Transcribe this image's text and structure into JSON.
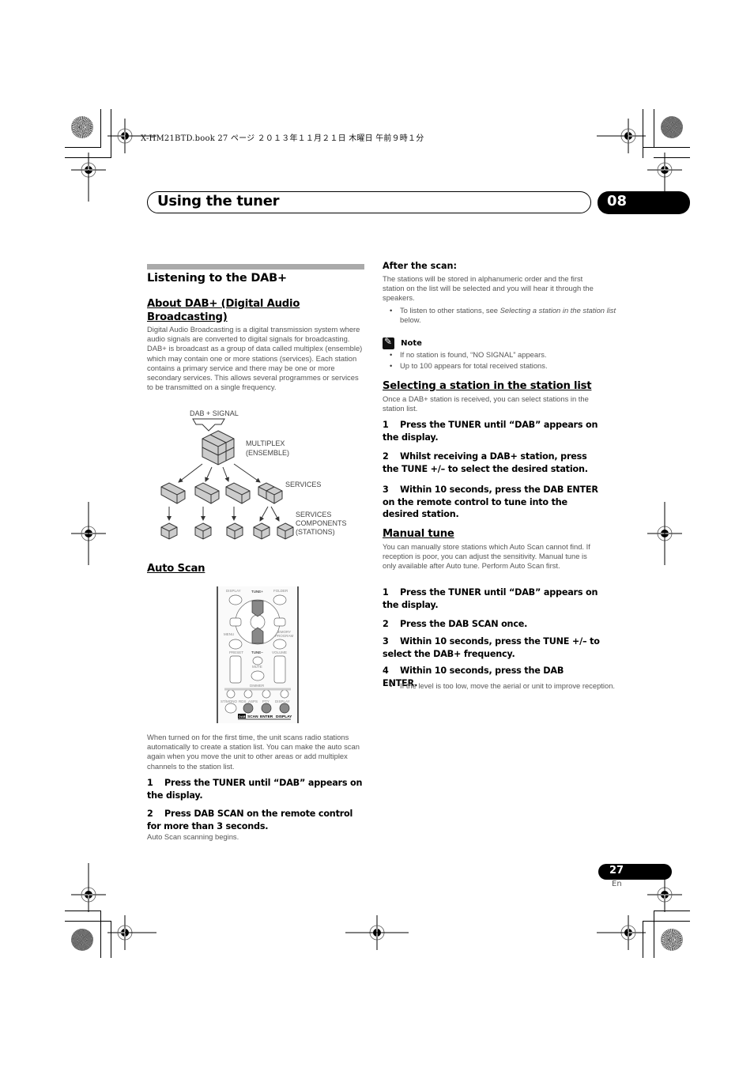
{
  "slug": {
    "text": "X-HM21BTD.book  27 ページ  ２０１３年１１月２１日  木曜日  午前９時１分"
  },
  "header": {
    "title": "Using the tuner",
    "chapter": "08"
  },
  "left_column": {
    "section_title": "Listening to the DAB+",
    "about": {
      "heading": "About DAB+ (Digital Audio Broadcasting)",
      "body": "Digital Audio Broadcasting is a digital transmission system where audio signals are converted to digital signals for broadcasting. DAB+ is broadcast as a group of data called multiplex (ensemble) which may contain one or more stations (services). Each station contains a primary service and there may be one or more secondary services. This allows several programmes or services to be transmitted on a single frequency."
    },
    "diagram": {
      "signal_label": "DAB + SIGNAL",
      "multiplex_label_1": "MULTIPLEX",
      "multiplex_label_2": "(ENSEMBLE)",
      "services_label": "SERVICES",
      "components_label_1": "SERVICES",
      "components_label_2": "COMPONENTS",
      "components_label_3": "(STATIONS)"
    },
    "auto_scan": {
      "heading": "Auto Scan",
      "remote": {
        "display": "DISPLAY",
        "folder": "FOLDER",
        "tune_plus": "TUNE+",
        "tune_minus": "TUNE–",
        "enter": "ENTER",
        "menu": "MENU",
        "memory_1": "MEMORY",
        "memory_2": "PROGRAM",
        "preset": "PRESET",
        "volume": "VOLUME",
        "mute": "MUTE",
        "dimmer": "DIMMER",
        "st_mono": "ST/MONO",
        "rds": "RDS",
        "asps": "ASPS",
        "pty": "PTY",
        "display2": "DISPLAY",
        "dab": "DAB",
        "scan": "SCAN",
        "enter2": "ENTER",
        "display3": "DISPLAY"
      },
      "body": "When turned on for the first time, the unit scans radio stations automatically to create a station list. You can make the auto scan again when you move the unit to other areas or add multiplex channels to the station list.",
      "steps": [
        {
          "num": "1",
          "text": "Press the TUNER until “DAB” appears on the display."
        },
        {
          "num": "2",
          "text": "Press DAB SCAN on the remote control for more than 3 seconds."
        }
      ],
      "after_step_note": "Auto Scan scanning begins."
    }
  },
  "right_column": {
    "after_scan": {
      "heading": "After the scan:",
      "body": "The stations will be stored in alphanumeric order and the first station on the list will be selected and you will hear it through the speakers.",
      "bullet_prefix": "To listen to other stations, see ",
      "bullet_italic": "Selecting a station in the station list",
      "bullet_suffix": " below."
    },
    "note": {
      "label": "Note",
      "items": [
        "If no station is found, “NO SIGNAL” appears.",
        "Up to 100 appears for total received stations."
      ]
    },
    "selecting": {
      "heading": "Selecting a station in the station list",
      "body": "Once a DAB+ station is received, you can select stations in the station list.",
      "steps": [
        {
          "num": "1",
          "text": "Press the TUNER until “DAB” appears on the display."
        },
        {
          "num": "2",
          "text": "Whilst receiving a DAB+ station, press the TUNE +/– to select the desired station."
        },
        {
          "num": "3",
          "text": "Within 10 seconds, press the DAB ENTER on the remote control to tune into the desired station."
        }
      ]
    },
    "manual": {
      "heading": "Manual tune",
      "body": "You can manually store stations which Auto Scan cannot find. If reception is poor, you can adjust the sensitivity. Manual tune is only available after Auto tune. Perform Auto Scan first.",
      "steps": [
        {
          "num": "1",
          "text": "Press the TUNER until “DAB” appears on the display."
        },
        {
          "num": "2",
          "text": "Press the DAB SCAN once."
        },
        {
          "num": "3",
          "text": "Within 10 seconds, press the TUNE +/– to select the DAB+ frequency."
        },
        {
          "num": "4",
          "text": "Within 10 seconds, press the DAB ENTER."
        }
      ],
      "bullet": "If the level is too low, move the aerial or unit to improve reception."
    }
  },
  "footer": {
    "page_number": "27",
    "language": "En"
  }
}
